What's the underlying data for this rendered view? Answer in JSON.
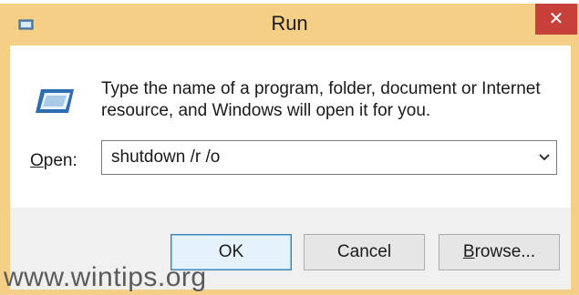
{
  "window": {
    "title": "Run",
    "close_glyph": "✕",
    "close_color": "#c7403a",
    "frame_color": "#f4cf85"
  },
  "icons": {
    "title_icon": "run-app-icon",
    "body_icon": "run-app-icon",
    "dropdown_icon": "chevron-down-icon"
  },
  "description": {
    "line1": "Type the name of a program, folder, document or Internet",
    "line2": "resource, and Windows will open it for you."
  },
  "open": {
    "label_mnemonic": "O",
    "label_rest": "pen:",
    "value": "shutdown /r /o"
  },
  "buttons": {
    "ok": "OK",
    "cancel": "Cancel",
    "browse_mnemonic": "B",
    "browse_rest": "rowse..."
  },
  "watermark": "www.wintips.org"
}
